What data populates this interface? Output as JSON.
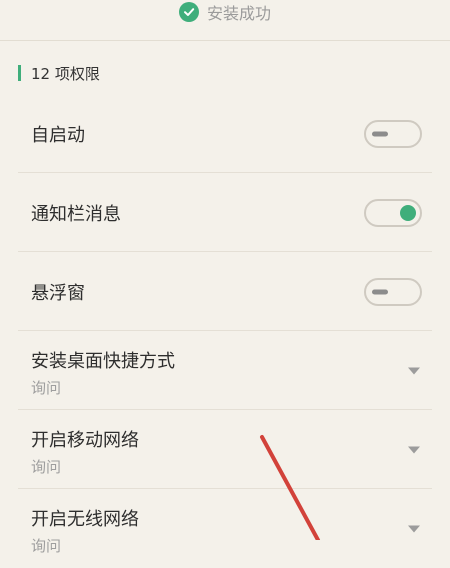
{
  "status": {
    "icon": "check-circle-icon",
    "text": "安装成功",
    "color": "#3fae7b"
  },
  "section": {
    "title": "12 项权限"
  },
  "permissions": [
    {
      "title": "自启动",
      "control": "toggle",
      "state": "off"
    },
    {
      "title": "通知栏消息",
      "control": "toggle",
      "state": "on"
    },
    {
      "title": "悬浮窗",
      "control": "toggle",
      "state": "off"
    },
    {
      "title": "安装桌面快捷方式",
      "subtitle": "询问",
      "control": "dropdown"
    },
    {
      "title": "开启移动网络",
      "subtitle": "询问",
      "control": "dropdown"
    },
    {
      "title": "开启无线网络",
      "subtitle": "询问",
      "control": "dropdown"
    }
  ],
  "colors": {
    "background": "#f4f1ea",
    "accent": "#3fae7b",
    "annotation_arrow": "#d2423a"
  }
}
